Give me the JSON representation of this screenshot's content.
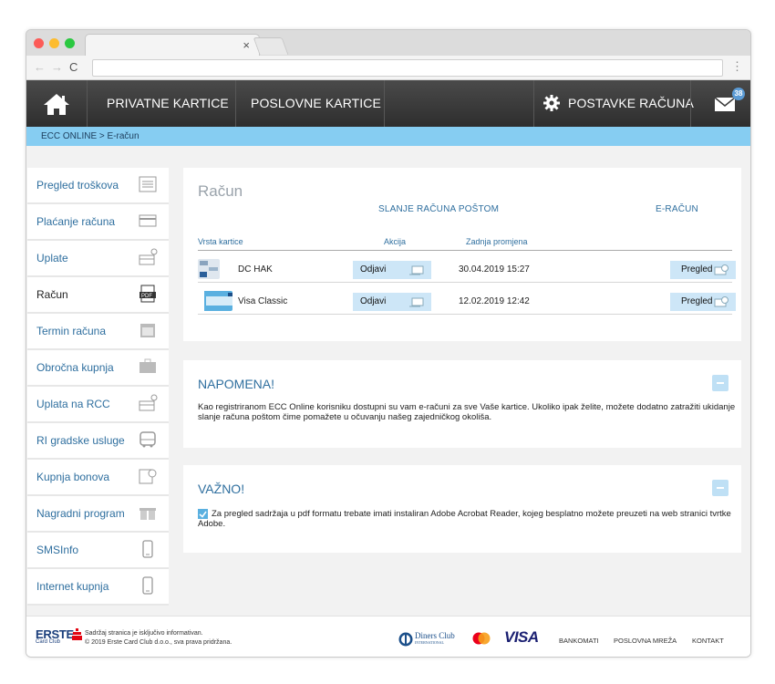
{
  "browser": {
    "tab_close": "×",
    "back": "←",
    "forward": "→",
    "reload": "C",
    "menu": "⋮"
  },
  "topnav": {
    "items": [
      "PRIVATNE KARTICE",
      "POSLOVNE KARTICE"
    ],
    "settings": "POSTAVKE RAČUNA",
    "badge": "38"
  },
  "breadcrumb": "ECC ONLINE > E-račun",
  "sidebar": {
    "items": [
      {
        "label": "Pregled troškova",
        "icon": "list-icon"
      },
      {
        "label": "Plaćanje računa",
        "icon": "card-icon"
      },
      {
        "label": "Uplate",
        "icon": "payment-icon"
      },
      {
        "label": "Račun",
        "icon": "pdf-icon"
      },
      {
        "label": "Termin računa",
        "icon": "calendar-icon"
      },
      {
        "label": "Obročna kupnja",
        "icon": "wallet-icon"
      },
      {
        "label": "Uplata na RCC",
        "icon": "payment-icon"
      },
      {
        "label": "RI gradske usluge",
        "icon": "bus-icon"
      },
      {
        "label": "Kupnja bonova",
        "icon": "coupon-icon"
      },
      {
        "label": "Nagradni program",
        "icon": "gift-icon"
      },
      {
        "label": "SMSInfo",
        "icon": "phone-icon"
      },
      {
        "label": "Internet kupnja",
        "icon": "phone-icon"
      }
    ],
    "active_index": 3
  },
  "racun": {
    "title": "Račun",
    "col_post": "SLANJE RAČUNA POŠTOM",
    "col_e": "E-RAČUN",
    "hdr_type": "Vrsta kartice",
    "hdr_action": "Akcija",
    "hdr_changed": "Zadnja promjena",
    "rows": [
      {
        "card": "DC HAK",
        "action": "Odjavi",
        "date": "30.04.2019 15:27",
        "ebtn": "Pregled"
      },
      {
        "card": "Visa Classic",
        "action": "Odjavi",
        "date": "12.02.2019 12:42",
        "ebtn": "Pregled"
      }
    ]
  },
  "napomena": {
    "title": "NAPOMENA!",
    "text": "Kao registriranom ECC Online korisniku dostupni su vam e-računi za sve Vaše kartice. Ukoliko ipak želite, možete dodatno zatražiti ukidanje slanje računa poštom čime pomažete u očuvanju našeg zajedničkog okoliša."
  },
  "vazno": {
    "title": "VAŽNO!",
    "text": "Za pregled sadržaja u pdf formatu trebate imati instaliran Adobe Acrobat Reader, kojeg besplatno možete preuzeti na web stranici tvrtke Adobe."
  },
  "footer": {
    "brand": "ERSTE",
    "brand_sub": "Card Club",
    "line1": "Sadržaj stranica je isključivo informativan.",
    "line2": "© 2019 Erste Card Club d.o.o., sva prava pridržana.",
    "diners": "Diners Club",
    "diners_sub": "INTERNATIONAL",
    "visa": "VISA",
    "links": [
      "BANKOMATI",
      "POSLOVNA MREŽA",
      "KONTAKT"
    ]
  },
  "colors": {
    "accent": "#2f6f9f",
    "breadcrumb_bg": "#86cdf2",
    "button_bg": "#cde6f7",
    "nav_bg": "#3b3b3b"
  }
}
